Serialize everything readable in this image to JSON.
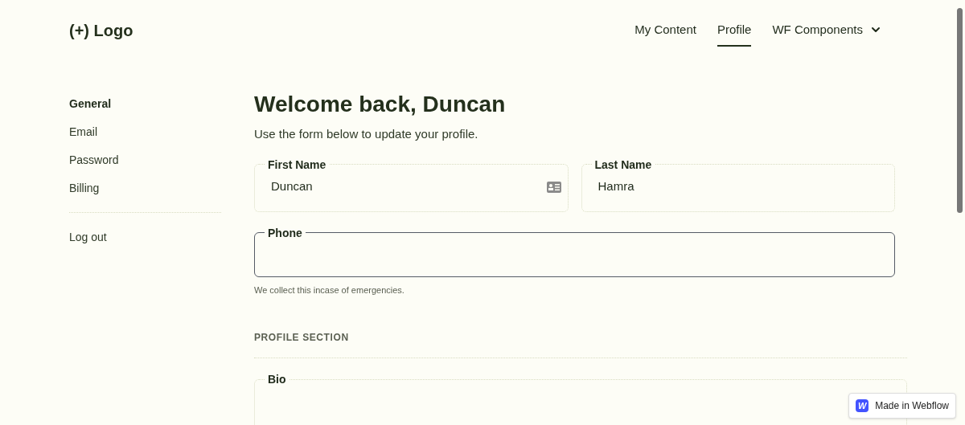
{
  "logo": "(+) Logo",
  "nav": [
    {
      "label": "My Content",
      "selected": false,
      "dropdown": false
    },
    {
      "label": "Profile",
      "selected": true,
      "dropdown": false
    },
    {
      "label": "WF Components",
      "selected": false,
      "dropdown": true
    }
  ],
  "sidebar": {
    "items": [
      {
        "label": "General",
        "selected": true
      },
      {
        "label": "Email",
        "selected": false
      },
      {
        "label": "Password",
        "selected": false
      },
      {
        "label": "Billing",
        "selected": false
      }
    ],
    "footer_items": [
      {
        "label": "Log out",
        "selected": false
      }
    ]
  },
  "heading": "Welcome back, Duncan",
  "subheading": "Use the form below to update your profile.",
  "name_fields": [
    {
      "label": "First Name",
      "value": "Duncan",
      "focused": false,
      "autofill": true
    },
    {
      "label": "Last Name",
      "value": "Hamra",
      "focused": false,
      "autofill": false
    }
  ],
  "phone_field": {
    "label": "Phone",
    "focused": true,
    "hint": "We collect this incase of emergencies."
  },
  "section_title": "PROFILE SECTION",
  "bio_field": {
    "label": "Bio",
    "focused": false
  },
  "badge": {
    "logo": "W",
    "text": "Made in Webflow"
  }
}
